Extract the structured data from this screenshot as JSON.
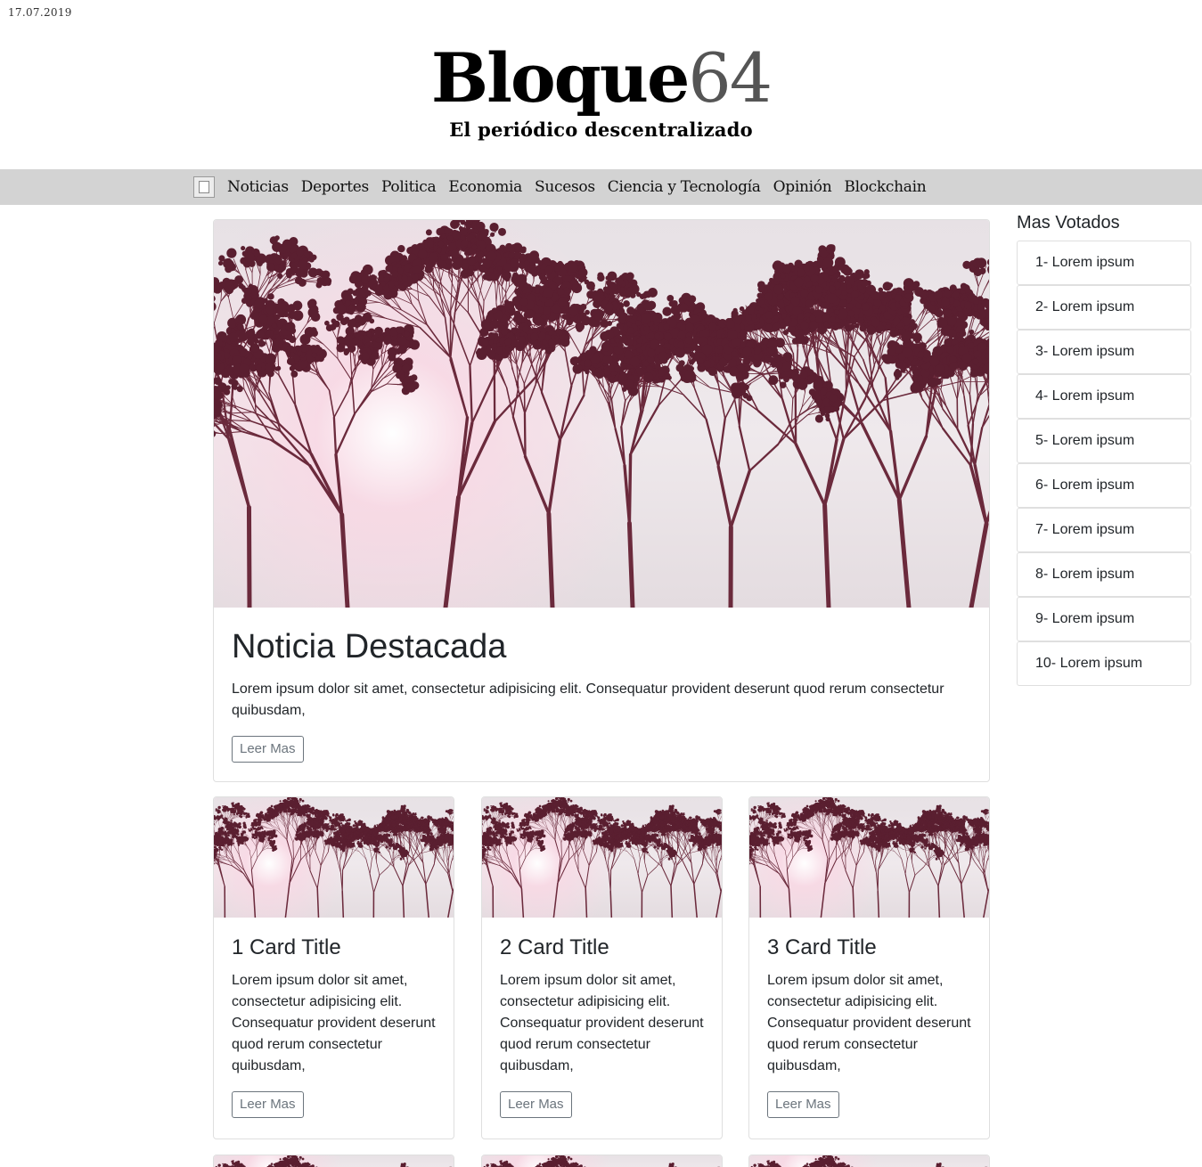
{
  "header": {
    "date": "17.07.2019",
    "logo_text": "Bloque",
    "logo_number": "64",
    "tagline": "El periódico descentralizado"
  },
  "nav": {
    "logo_icon": "broken-image-icon",
    "items": [
      "Noticias",
      "Deportes",
      "Politica",
      "Economia",
      "Sucesos",
      "Ciencia y Tecnología",
      "Opinión",
      "Blockchain"
    ]
  },
  "featured": {
    "title": "Noticia Destacada",
    "text": "Lorem ipsum dolor sit amet, consectetur adipisicing elit. Consequatur provident deserunt quod rerum consectetur quibusdam,",
    "button": "Leer Mas"
  },
  "cards": [
    {
      "title": "1 Card Title",
      "text": "Lorem ipsum dolor sit amet, consectetur adipisicing elit. Consequatur provident deserunt quod rerum consectetur quibusdam,",
      "button": "Leer Mas"
    },
    {
      "title": "2 Card Title",
      "text": "Lorem ipsum dolor sit amet, consectetur adipisicing elit. Consequatur provident deserunt quod rerum consectetur quibusdam,",
      "button": "Leer Mas"
    },
    {
      "title": "3 Card Title",
      "text": "Lorem ipsum dolor sit amet, consectetur adipisicing elit. Consequatur provident deserunt quod rerum consectetur quibusdam,",
      "button": "Leer Mas"
    }
  ],
  "sidebar": {
    "title": "Mas Votados",
    "items": [
      "1- Lorem ipsum",
      "2- Lorem ipsum",
      "3- Lorem ipsum",
      "4- Lorem ipsum",
      "5- Lorem ipsum",
      "6- Lorem ipsum",
      "7- Lorem ipsum",
      "8- Lorem ipsum",
      "9- Lorem ipsum",
      "10- Lorem ipsum"
    ]
  },
  "colors": {
    "nav_background": "#d3d3d3",
    "logo_number": "#555555",
    "button_outline": "#6c757d",
    "card_border": "#dfdfdf"
  }
}
